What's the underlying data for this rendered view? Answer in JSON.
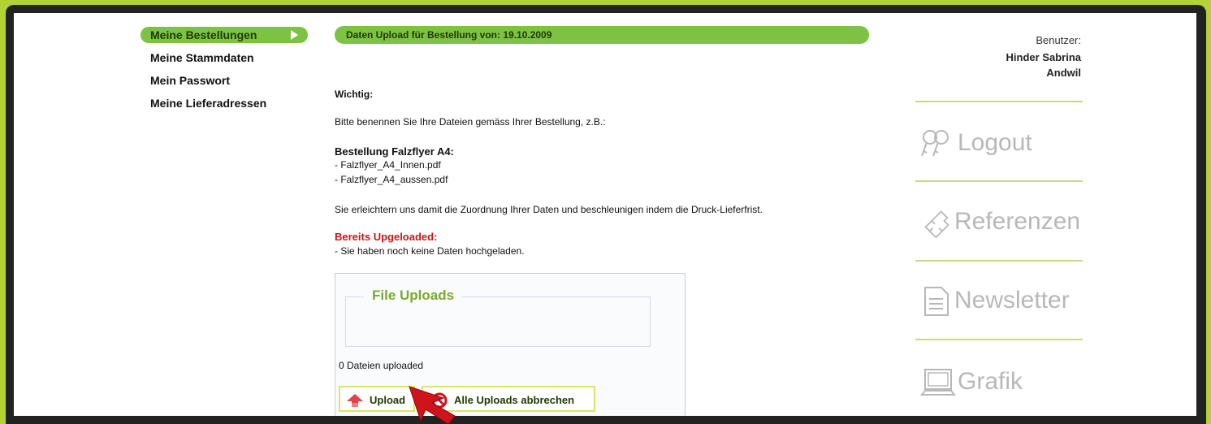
{
  "nav": {
    "items": [
      {
        "label": "Meine Bestellungen",
        "active": true
      },
      {
        "label": "Meine Stammdaten"
      },
      {
        "label": "Mein Passwort"
      },
      {
        "label": "Meine Lieferadressen"
      }
    ]
  },
  "main": {
    "title": "Daten Upload für Bestellung von: 19.10.2009",
    "important": "Wichtig:",
    "instruction": "Bitte benennen Sie Ihre Dateien gemäss Ihrer Bestellung, z.B.:",
    "example_title": "Bestellung Falzflyer A4:",
    "example_line1": "- Falzflyer_A4_Innen.pdf",
    "example_line2": "- Falzflyer_A4_aussen.pdf",
    "benefit": "Sie erleichtern uns damit die Zuordnung Ihrer Daten und beschleunigen indem die Druck-Lieferfrist.",
    "uploaded_title": "Bereits Upgeloaded:",
    "uploaded_none": "- Sie haben noch keine Daten hochgeladen."
  },
  "uploader": {
    "legend": "File Uploads",
    "count_text": "0 Dateien uploaded",
    "upload_button": "Upload",
    "cancel_button": "Alle Uploads abbrechen"
  },
  "user": {
    "label": "Benutzer:",
    "name": "Hinder Sabrina",
    "city": "Andwil"
  },
  "side_menu": {
    "logout": "Logout",
    "references": "Referenzen",
    "newsletter": "Newsletter",
    "grafik": "Grafik"
  },
  "colors": {
    "brand_green": "#7dc242",
    "frame_lime": "#b3d334",
    "alert_red": "#d0121b"
  }
}
